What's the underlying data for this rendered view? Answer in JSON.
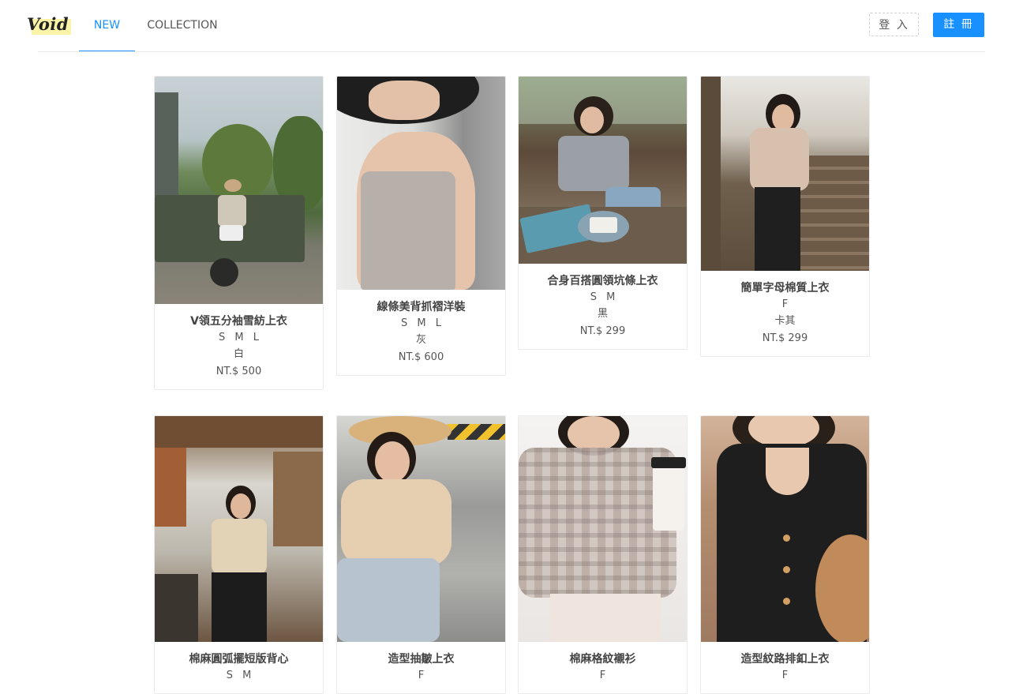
{
  "brand": {
    "logo_text": "Void"
  },
  "nav": {
    "tabs": [
      {
        "label": "NEW"
      },
      {
        "label": "COLLECTION"
      }
    ]
  },
  "auth": {
    "login_label": "登 入",
    "register_label": "註 冊"
  },
  "colors": {
    "accent": "#1890ff",
    "border": "#ebebeb"
  },
  "products": [
    {
      "name": "V領五分袖雪紡上衣",
      "sizes": "S M L",
      "color": "白",
      "price": "NT.$ 500"
    },
    {
      "name": "線條美背抓褶洋裝",
      "sizes": "S M L",
      "color": "灰",
      "price": "NT.$ 600"
    },
    {
      "name": "合身百搭圓領坑條上衣",
      "sizes": "S M",
      "color": "黑",
      "price": "NT.$ 299"
    },
    {
      "name": "簡單字母棉質上衣",
      "sizes": "F",
      "color": "卡其",
      "price": "NT.$ 299"
    },
    {
      "name": "棉麻圓弧擺短版背心",
      "sizes": "S M",
      "color": "",
      "price": ""
    },
    {
      "name": "造型抽皺上衣",
      "sizes": "F",
      "color": "",
      "price": ""
    },
    {
      "name": "棉麻格紋襯衫",
      "sizes": "F",
      "color": "",
      "price": ""
    },
    {
      "name": "造型紋路排釦上衣",
      "sizes": "F",
      "color": "",
      "price": ""
    }
  ]
}
